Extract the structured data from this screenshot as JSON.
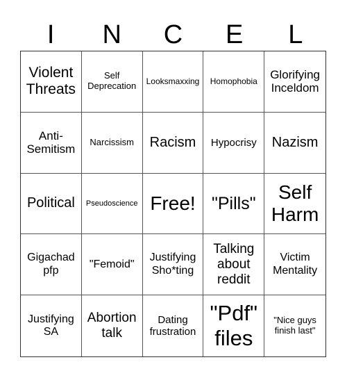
{
  "card": {
    "header_letters": [
      "I",
      "N",
      "C",
      "E",
      "L"
    ],
    "cells": [
      "Violent Threats",
      "Self Deprecation",
      "Looksmaxxing",
      "Homophobia",
      "Glorifying Inceldom",
      "Anti-Semitism",
      "Narcissism",
      "Racism",
      "Hypocrisy",
      "Nazism",
      "Political",
      "Pseudoscience",
      "Free!",
      "\"Pills\"",
      "Self Harm",
      "Gigachad pfp",
      "\"Femoid\"",
      "Justifying Sho*ting",
      "Talking about reddit",
      "Victim Mentality",
      "Justifying SA",
      "Abortion talk",
      "Dating frustration",
      "\"Pdf\" files",
      "\"Nice guys finish last\""
    ],
    "free_space_index": 12
  }
}
